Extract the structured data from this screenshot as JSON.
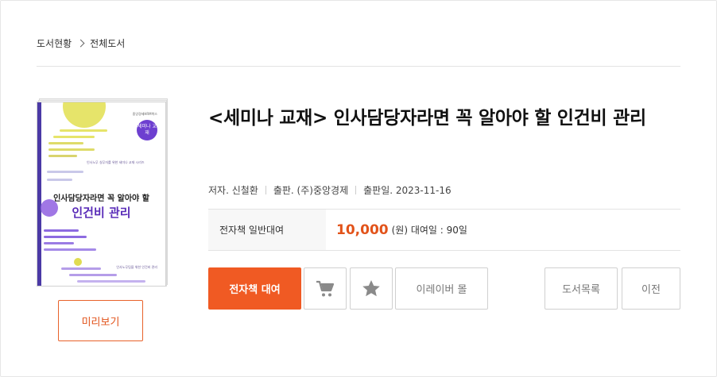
{
  "breadcrumb": {
    "items": [
      "도서현황",
      "전체도서"
    ]
  },
  "book": {
    "title": "<세미나 교재> 인사담당자라면 꼭 알아야 할 인건비 관리",
    "author": "저자. 신철환",
    "publisher": "출판. (주)중앙경제",
    "pub_date": "출판일. 2023-11-16"
  },
  "cover": {
    "publisher_mark": "중앙경제HRM북스",
    "badge": "세미나 교재",
    "subtitle": "인사노무 실무자를 위한 세미나 교재 시리즈",
    "title_line1": "인사담당자라면 꼭 알아야 할",
    "title_line2": "인건비 관리",
    "footer": "인사노무팀을 위한 인건비 관리",
    "colors": {
      "spine": "#4b3aa6",
      "accent": "#5a2db8",
      "yellow": "#e6e46a"
    }
  },
  "preview_label": "미리보기",
  "pricing": {
    "label": "전자책 일반대여",
    "price": "10,000",
    "unit": "(원) 대여일 : 90일"
  },
  "actions": {
    "rent": "전자책 대여",
    "cart_icon": "cart-icon",
    "wish_icon": "star-icon",
    "mall": "이레이버 몰",
    "list": "도서목록",
    "prev": "이전"
  },
  "colors": {
    "accent": "#f05a23"
  }
}
